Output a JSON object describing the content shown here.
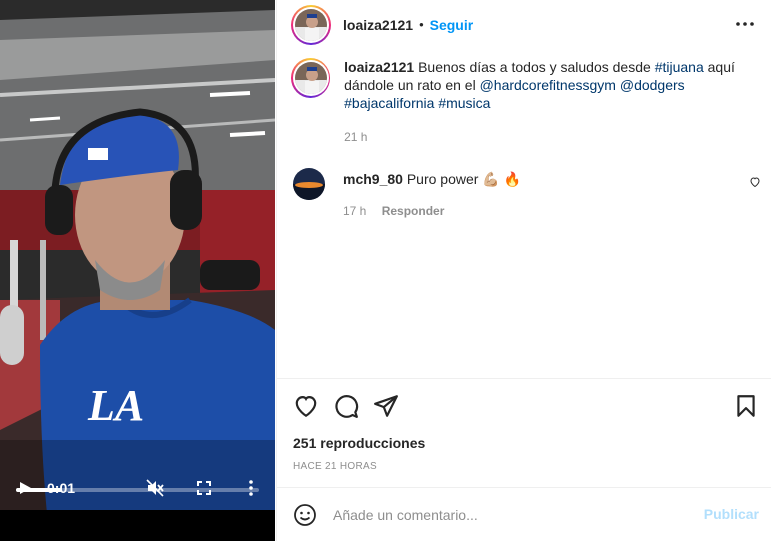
{
  "post": {
    "username": "loaiza2121",
    "separator": "•",
    "follow_label": "Seguir",
    "caption": {
      "username": "loaiza2121",
      "text_1": " Buenos días a todos y saludos desde ",
      "tag_1": "#tijuana",
      "text_2": " aquí dándole un rato en el ",
      "tag_2": "@hardcorefitnessgym",
      "text_3": " ",
      "tag_3": "@dodgers",
      "text_4": " ",
      "tag_4": "#bajacalifornia",
      "text_5": " ",
      "tag_5": "#musica",
      "time": "21 h"
    },
    "comments": [
      {
        "username": "mch9_80",
        "text": " Puro power 💪🏼 🔥",
        "time": "17 h",
        "reply_label": "Responder"
      }
    ],
    "views": "251 reproducciones",
    "posted_ago": "HACE 21 HORAS"
  },
  "video": {
    "time": "0:01",
    "progress": 0.19
  },
  "composer": {
    "placeholder": "Añade un comentario...",
    "publish_label": "Publicar"
  },
  "icons": {
    "more": "more-horizontal-icon",
    "like": "heart-icon",
    "comment": "comment-icon",
    "share": "share-icon",
    "save": "bookmark-icon",
    "emoji": "emoji-icon",
    "play": "play-icon",
    "mute": "muted-icon",
    "fullscreen": "fullscreen-icon",
    "video_more": "more-vertical-icon"
  },
  "colors": {
    "accent": "#0095f6",
    "link": "#00376b",
    "muted": "#8e8e8e",
    "publish_disabled": "#b2dffc"
  }
}
